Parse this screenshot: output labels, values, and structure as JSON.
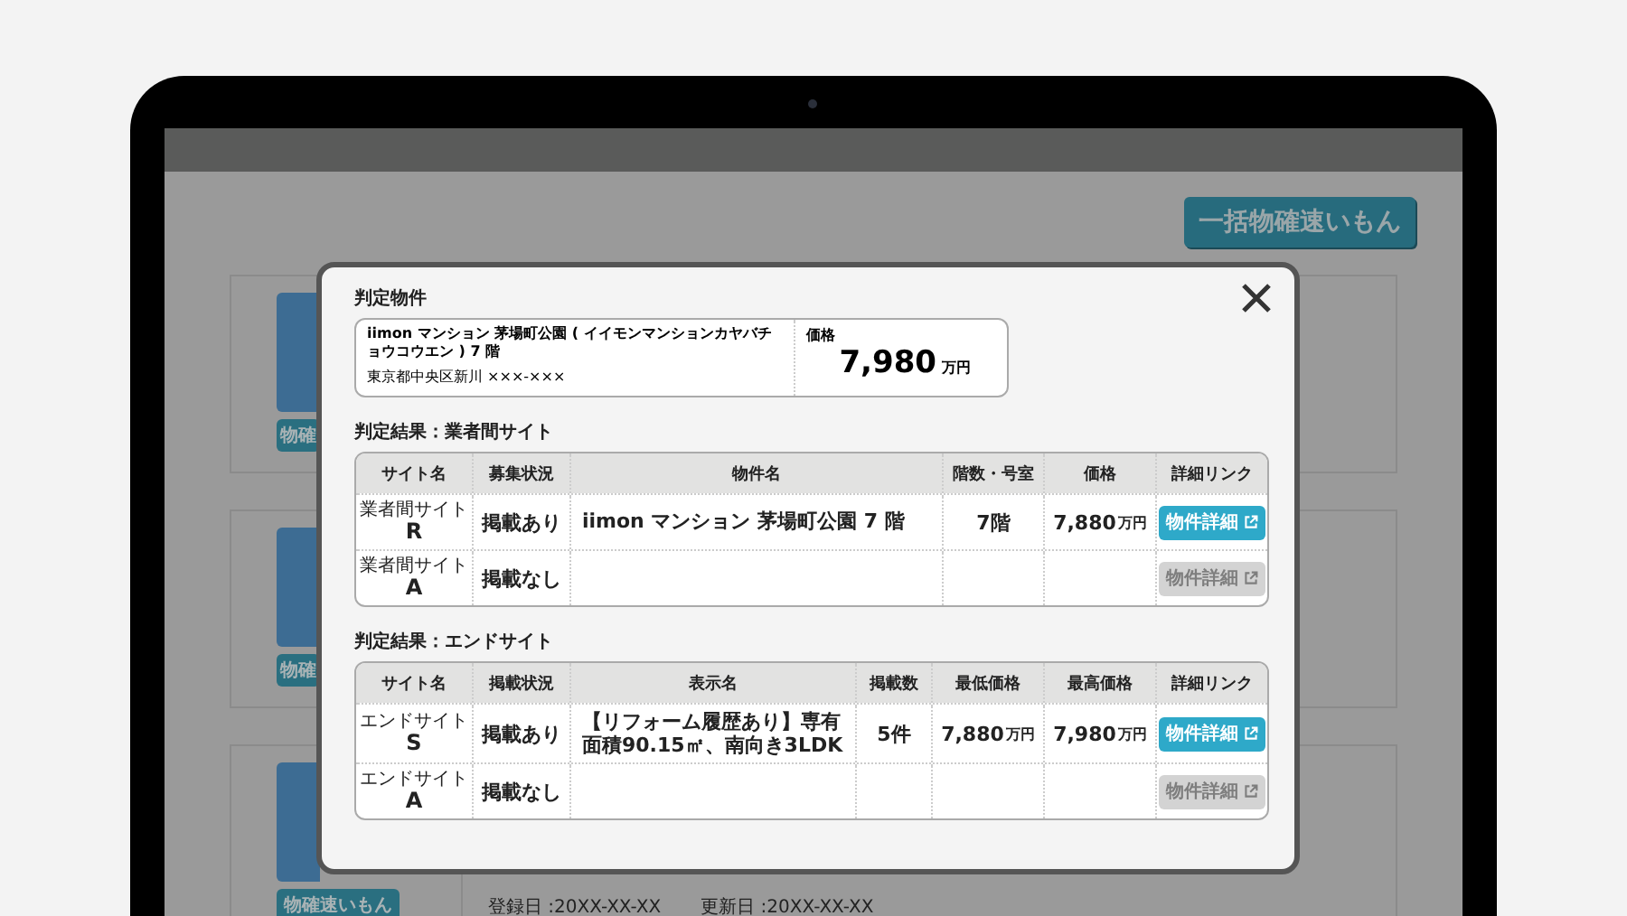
{
  "page_header": {
    "bulk_button": "一括物確速いもん"
  },
  "listings": [
    {
      "button": "物確"
    },
    {
      "button": "物確"
    },
    {
      "button": "物確速いもん",
      "registered": "登録日 :20XX-XX-XX",
      "updated": "更新日 :20XX-XX-XX"
    }
  ],
  "modal": {
    "title": "判定物件",
    "property": {
      "name": "iimon マンション 茅場町公園 ( イイモンマンションカヤバチョウコウエン ) 7 階",
      "address": "東京都中央区新川 ×××-×××",
      "price_label": "価格",
      "price": "7,980",
      "price_unit": "万円"
    },
    "sections": [
      {
        "title": "判定結果：業者間サイト",
        "columns": [
          {
            "kind": "site",
            "label": "サイト名"
          },
          {
            "kind": "status",
            "label": "募集状況"
          },
          {
            "kind": "name",
            "label": "物件名"
          },
          {
            "kind": "floor",
            "label": "階数・号室"
          },
          {
            "kind": "price",
            "label": "価格"
          },
          {
            "kind": "link",
            "label": "詳細リンク"
          }
        ],
        "rows": [
          {
            "cells": [
              {
                "kind": "site",
                "caption": "業者間サイト",
                "text": "R"
              },
              {
                "kind": "text",
                "text": "掲載あり"
              },
              {
                "kind": "name",
                "text": "iimon マンション 茅場町公園 7 階"
              },
              {
                "kind": "text",
                "text": "7階"
              },
              {
                "kind": "price",
                "text": "7,880",
                "unit": "万円"
              },
              {
                "kind": "link",
                "text": "物件詳細",
                "disabled": false
              }
            ]
          },
          {
            "cells": [
              {
                "kind": "site",
                "caption": "業者間サイト",
                "text": "A"
              },
              {
                "kind": "text",
                "text": "掲載なし"
              },
              {
                "kind": "empty"
              },
              {
                "kind": "empty"
              },
              {
                "kind": "empty"
              },
              {
                "kind": "link",
                "text": "物件詳細",
                "disabled": true
              }
            ]
          }
        ]
      },
      {
        "title": "判定結果：エンドサイト",
        "columns": [
          {
            "kind": "site",
            "label": "サイト名"
          },
          {
            "kind": "status",
            "label": "掲載状況"
          },
          {
            "kind": "name",
            "label": "表示名"
          },
          {
            "kind": "count",
            "label": "掲載数"
          },
          {
            "kind": "price",
            "label": "最低価格"
          },
          {
            "kind": "price",
            "label": "最高価格"
          },
          {
            "kind": "link",
            "label": "詳細リンク"
          }
        ],
        "rows": [
          {
            "cells": [
              {
                "kind": "site",
                "caption": "エンドサイト",
                "text": "S"
              },
              {
                "kind": "text",
                "text": "掲載あり"
              },
              {
                "kind": "name",
                "text": "【リフォーム履歴あり】専有面積90.15㎡、南向き3LDK"
              },
              {
                "kind": "text",
                "text": "5件"
              },
              {
                "kind": "price",
                "text": "7,880",
                "unit": "万円"
              },
              {
                "kind": "price",
                "text": "7,980",
                "unit": "万円"
              },
              {
                "kind": "link",
                "text": "物件詳細",
                "disabled": false
              }
            ]
          },
          {
            "cells": [
              {
                "kind": "site",
                "caption": "エンドサイト",
                "text": "A"
              },
              {
                "kind": "text",
                "text": "掲載なし"
              },
              {
                "kind": "empty"
              },
              {
                "kind": "empty"
              },
              {
                "kind": "empty"
              },
              {
                "kind": "empty"
              },
              {
                "kind": "link",
                "text": "物件詳細",
                "disabled": true
              }
            ]
          }
        ]
      }
    ]
  }
}
